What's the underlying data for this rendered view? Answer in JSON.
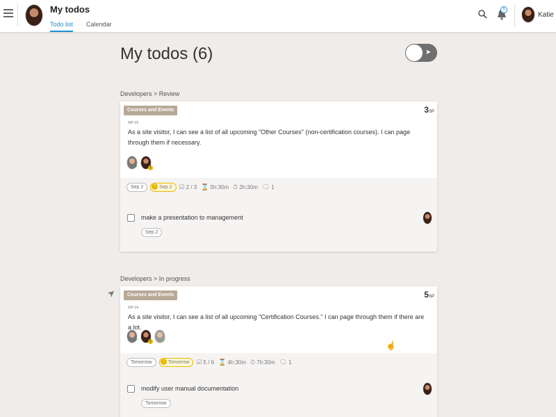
{
  "header": {
    "title": "My todos",
    "tabs": [
      {
        "label": "Todo list",
        "active": true
      },
      {
        "label": "Calendar",
        "active": false
      }
    ],
    "notification_count": "5",
    "user_name": "Katie"
  },
  "page": {
    "title": "My todos (6)",
    "accent_color": "#1b8fd6",
    "badge_color": "#e6b800",
    "category_color": "#b8a896"
  },
  "groups": [
    {
      "label": "Developers > Review",
      "card": {
        "category": "Courses and Events",
        "points": "3",
        "points_unit": "SP",
        "code": "WP-25",
        "description": "As a site visitor, I can see a list of all upcoming \"Other Courses\" (non-certification courses). I can page through them if necessary.",
        "due_date": "Sep 2",
        "warn_date": "Sep 2",
        "member_badge": "1",
        "checklist": "2 / 3",
        "estimate": "5h:30m",
        "spent": "2h:30m",
        "comments": "1",
        "subtask": {
          "text": "make a presentation to management",
          "date": "Sep 2"
        }
      }
    },
    {
      "label": "Developers > In progress",
      "card": {
        "category": "Courses and Events",
        "points": "5",
        "points_unit": "SP",
        "code": "WP-24",
        "description": "As a site visitor, I can see a list of all upcoming \"Certification Courses.\" I can page through them if there are a lot.",
        "due_date": "Tomorrow",
        "warn_date": "Tomorrow",
        "member_badge": "1",
        "checklist": "5 / 6",
        "estimate": "4h:30m",
        "spent": "7h:30m",
        "comments": "1",
        "subtask": {
          "text": "modify user manual documentation",
          "date": "Tomorrow"
        }
      }
    }
  ],
  "icons": [
    "hamburger-icon",
    "search-icon",
    "bell-icon",
    "pin-icon",
    "checklist-icon",
    "hourglass-icon",
    "stopwatch-icon",
    "comment-icon",
    "hand-cursor-icon"
  ]
}
